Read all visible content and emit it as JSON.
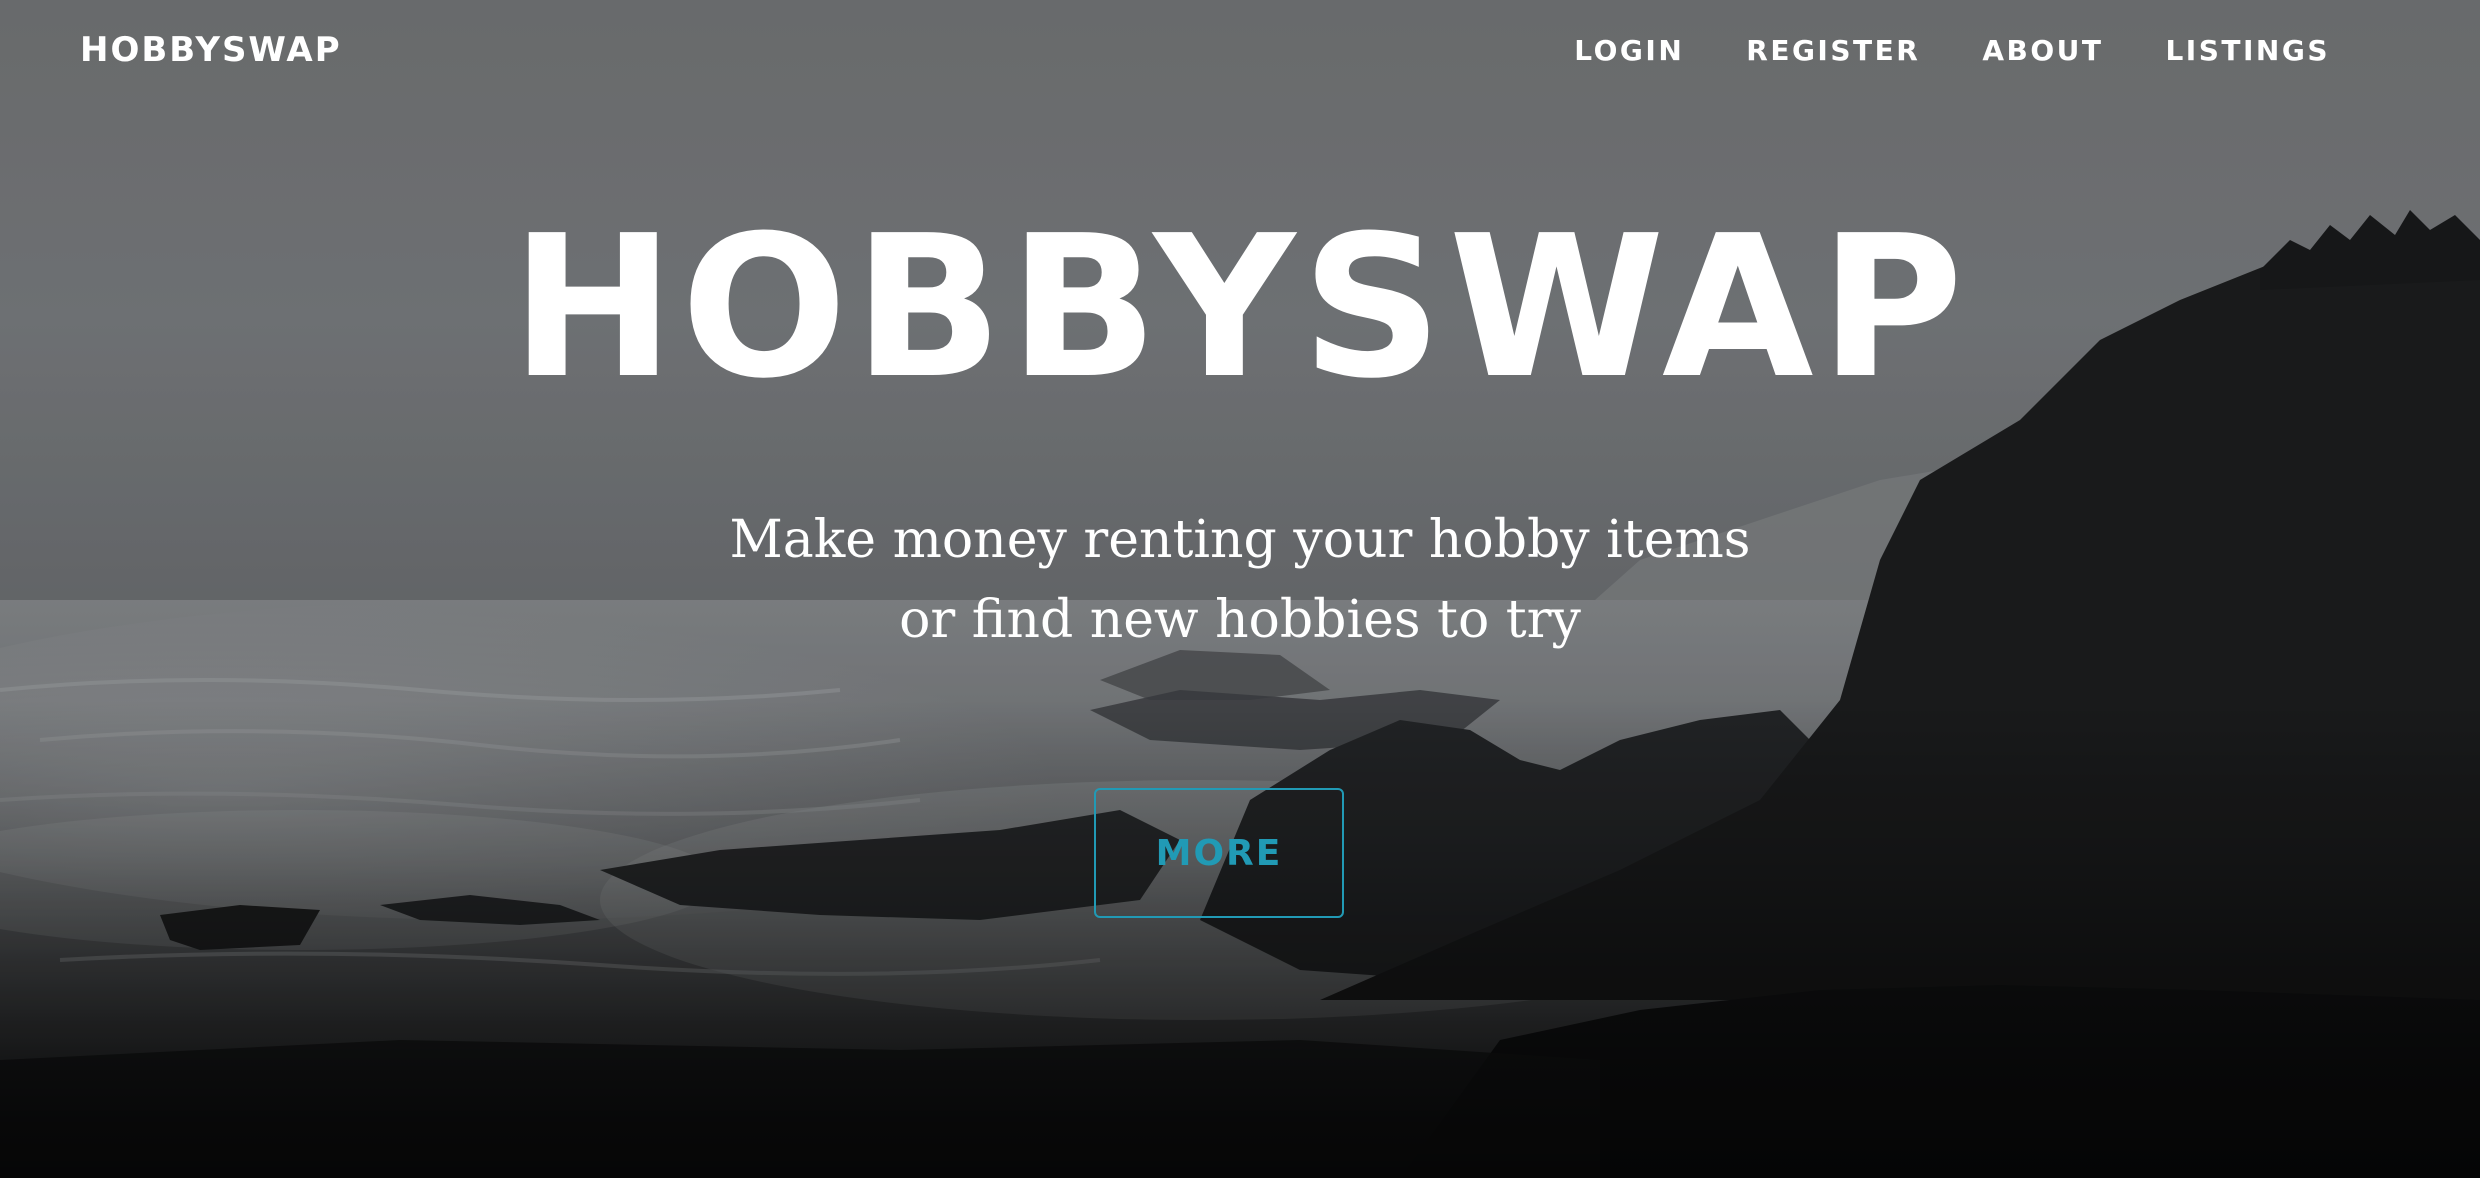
{
  "header": {
    "brand": "HOBBYSWAP",
    "nav": {
      "login": "LOGIN",
      "register": "REGISTER",
      "about": "ABOUT",
      "listings": "LISTINGS"
    }
  },
  "hero": {
    "title": "HOBBYSWAP",
    "subtitle_line1": "Make money renting your hobby items",
    "subtitle_line2": "or find new hobbies to try",
    "cta_label": "MORE"
  },
  "colors": {
    "accent": "#219ab5",
    "text": "#ffffff"
  }
}
